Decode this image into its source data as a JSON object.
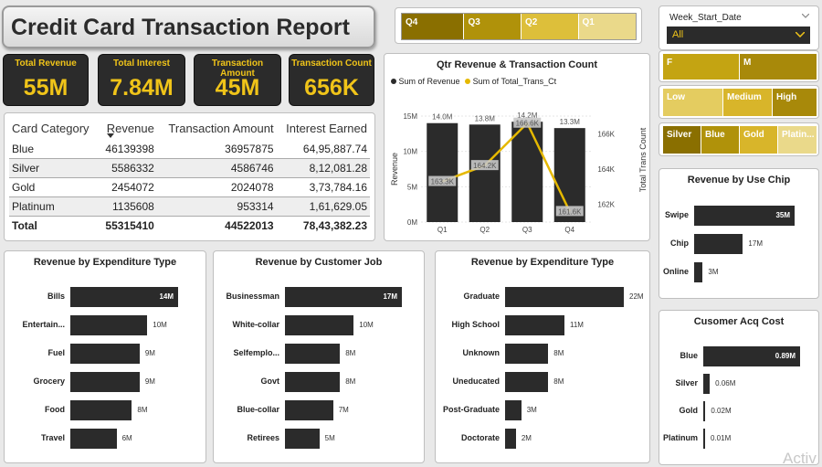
{
  "report_title": "Credit Card Transaction Report",
  "kpis": [
    {
      "label": "Total Revenue",
      "value": "55M"
    },
    {
      "label": "Total Interest",
      "value": "7.84M"
    },
    {
      "label": "Transaction Amount",
      "value": "45M"
    },
    {
      "label": "Transaction Count",
      "value": "656K"
    }
  ],
  "table": {
    "headers": [
      "Card Category",
      "Revenue",
      "Transaction Amount",
      "Interest Earned"
    ],
    "rows": [
      [
        "Blue",
        "46139398",
        "36957875",
        "64,95,887.74"
      ],
      [
        "Silver",
        "5586332",
        "4586746",
        "8,12,081.28"
      ],
      [
        "Gold",
        "2454072",
        "2024078",
        "3,73,784.16"
      ],
      [
        "Platinum",
        "1135608",
        "953314",
        "1,61,629.05"
      ]
    ],
    "total": [
      "Total",
      "55315410",
      "44522013",
      "78,43,382.23"
    ]
  },
  "quarter_slicer": [
    "Q4",
    "Q3",
    "Q2",
    "Q1"
  ],
  "week_slicer": {
    "label": "Week_Start_Date",
    "value": "All"
  },
  "gender_slicer": [
    "F",
    "M"
  ],
  "income_slicer": [
    "Low",
    "Medium",
    "High"
  ],
  "card_slicer": [
    "Silver",
    "Blue",
    "Gold",
    "Platin..."
  ],
  "colors": {
    "dark": "#2b2b2b",
    "gold": "#f0c419",
    "line": "#e5b800"
  },
  "combo": {
    "title": "Qtr Revenue & Transaction Count",
    "legend": [
      "Sum of Revenue",
      "Sum of Total_Trans_Ct"
    ],
    "y_left_label": "Revenue",
    "y_right_label": "Total Trans Count",
    "y_left_ticks": [
      "0M",
      "5M",
      "10M",
      "15M"
    ],
    "y_right_ticks": [
      "162K",
      "164K",
      "166K"
    ]
  },
  "chart_data": [
    {
      "type": "bar+line",
      "title": "Qtr Revenue & Transaction Count",
      "categories": [
        "Q1",
        "Q2",
        "Q3",
        "Q4"
      ],
      "series": [
        {
          "name": "Sum of Revenue",
          "values": [
            14.0,
            13.8,
            14.2,
            13.3
          ],
          "labels": [
            "14.0M",
            "13.8M",
            "14.2M",
            "13.3M"
          ]
        },
        {
          "name": "Sum of Total_Trans_Ct",
          "values": [
            163.3,
            164.2,
            166.6,
            161.6
          ],
          "labels": [
            "163.3K",
            "164.2K",
            "166.6K",
            "161.6K"
          ]
        }
      ],
      "ylim_left": [
        0,
        15
      ],
      "ylim_right": [
        161,
        167
      ]
    },
    {
      "type": "bar",
      "title": "Revenue by Expenditure Type",
      "categories": [
        "Bills",
        "Entertain...",
        "Fuel",
        "Grocery",
        "Food",
        "Travel"
      ],
      "values": [
        14,
        10,
        9,
        9,
        8,
        6
      ],
      "labels": [
        "14M",
        "10M",
        "9M",
        "9M",
        "8M",
        "6M"
      ]
    },
    {
      "type": "bar",
      "title": "Revenue by Customer Job",
      "categories": [
        "Businessman",
        "White-collar",
        "Selfemplo...",
        "Govt",
        "Blue-collar",
        "Retirees"
      ],
      "values": [
        17,
        10,
        8,
        8,
        7,
        5
      ],
      "labels": [
        "17M",
        "10M",
        "8M",
        "8M",
        "7M",
        "5M"
      ]
    },
    {
      "type": "bar",
      "title": "Revenue by Expenditure Type",
      "categories": [
        "Graduate",
        "High School",
        "Unknown",
        "Uneducated",
        "Post-Graduate",
        "Doctorate"
      ],
      "values": [
        22,
        11,
        8,
        8,
        3,
        2
      ],
      "labels": [
        "22M",
        "11M",
        "8M",
        "8M",
        "3M",
        "2M"
      ]
    },
    {
      "type": "bar",
      "title": "Revenue by Use Chip",
      "categories": [
        "Swipe",
        "Chip",
        "Online"
      ],
      "values": [
        35,
        17,
        3
      ],
      "labels": [
        "35M",
        "17M",
        "3M"
      ]
    },
    {
      "type": "bar",
      "title": "Cusomer Acq Cost",
      "categories": [
        "Blue",
        "Silver",
        "Gold",
        "Platinum"
      ],
      "values": [
        0.89,
        0.06,
        0.02,
        0.01
      ],
      "labels": [
        "0.89M",
        "0.06M",
        "0.02M",
        "0.01M"
      ]
    }
  ],
  "watermark": "Activ"
}
